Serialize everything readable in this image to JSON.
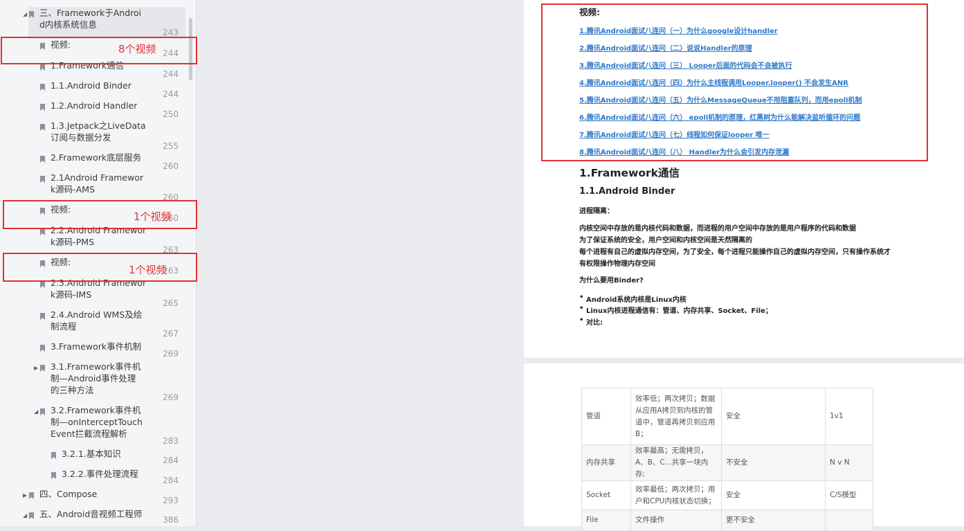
{
  "toc": [
    {
      "label": "三、Framework于Android内核系统信息",
      "lines": "三、Framework于Androi\nd内核系统信息",
      "page": "243",
      "expanded": true
    },
    {
      "label": "视频:",
      "lines": "视频:",
      "page": "244"
    },
    {
      "label": "1.Framework通信",
      "lines": "1.Framework通信",
      "page": "244"
    },
    {
      "label": "1.1.Android Binder",
      "lines": "1.1.Android Binder",
      "page": "244"
    },
    {
      "label": "1.2.Android Handler",
      "lines": "1.2.Android Handler",
      "page": "250"
    },
    {
      "label": "1.3.Jetpack之LiveData订阅与数据分发",
      "lines": "1.3.Jetpack之LiveData\n订阅与数据分发",
      "page": "255"
    },
    {
      "label": "2.Framework底层服务",
      "lines": "2.Framework底层服务",
      "page": "260"
    },
    {
      "label": "2.1Android Framework源码-AMS",
      "lines": "2.1Android Framewor\nk源码-AMS",
      "page": "260"
    },
    {
      "label": "视频:",
      "lines": "视频:",
      "page": "260"
    },
    {
      "label": "2.2.Android Framework源码-PMS",
      "lines": "2.2.Android Framewor\nk源码-PMS",
      "page": "263"
    },
    {
      "label": "视频:",
      "lines": "视频:",
      "page": "263"
    },
    {
      "label": "2.3.Android Framework源码-IMS",
      "lines": "2.3.Android Framewor\nk源码-IMS",
      "page": "265"
    },
    {
      "label": "2.4.Android WMS及绘制流程",
      "lines": "2.4.Android WMS及绘\n制流程",
      "page": "267"
    },
    {
      "label": "3.Framework事件机制",
      "lines": "3.Framework事件机制",
      "page": "269"
    },
    {
      "label": "3.1.Framework事件机制—Android事件处理的三种方法",
      "lines": "3.1.Framework事件机\n制—Android事件处理\n的三种方法",
      "page": "269",
      "collapsed": true
    },
    {
      "label": "3.2.Framework事件机制—onInterceptTouchEvent拦截流程解析",
      "lines": "3.2.Framework事件机\n制—onInterceptTouch\nEvent拦截流程解析",
      "page": "283",
      "expanded": true
    },
    {
      "label": "3.2.1.基本知识",
      "lines": "3.2.1.基本知识",
      "page": "284"
    },
    {
      "label": "3.2.2.事件处理流程",
      "lines": "3.2.2.事件处理流程",
      "page": "284"
    },
    {
      "label": "四、Compose",
      "lines": "四、Compose",
      "page": "293",
      "collapsed": true
    },
    {
      "label": "五、Android音视频工程师",
      "lines": "五、Android音视频工程师",
      "page": "386",
      "expanded": true
    }
  ],
  "annotations": [
    "8个视频",
    "1个视频",
    "1个视频"
  ],
  "doc": {
    "video_heading": "视频:",
    "video_links": [
      "1.腾讯Android面试八连问（一）为什么google设计handler",
      "2.腾讯Android面试八连问（二）说说Handler的原理",
      "3.腾讯Android面试八连问（三） Looper后面的代码会不会被执行",
      "4.腾讯Android面试八连问（四）为什么主线程调用Looper.looper() 不会发生ANR",
      "5.腾讯Android面试八连问（五）为什么MessageQueue不用阻塞队列，而用epoll机制",
      "6.腾讯Android面试八连问（六） epoll机制的原理，红黑树为什么能解决监听循环的问题",
      "7.腾讯Android面试八连问（七）线程如何保证looper 唯一",
      "8.腾讯Android面试八连问（八） Handler为什么会引发内存泄漏"
    ],
    "h1": "1.Framework通信",
    "h2": "1.1.Android Binder",
    "isolation_title": "进程隔离：",
    "isolation_paras": [
      "内核空间中存放的是内核代码和数据，而进程的用户空间中存放的是用户程序的代码和数据",
      "为了保证系统的安全，用户空间和内核空间是天然隔离的",
      "每个进程有自己的虚拟内存空间，为了安全，每个进程只能操作自己的虚拟内存空间，只有操作系统才",
      "有权限操作物理内存空间"
    ],
    "why_binder": "为什么要用Binder?",
    "bullets": [
      "Android系统内核是Linux内核",
      "Linux内核进程通信有：管道、内存共享、Socket、File；",
      "对比:"
    ]
  },
  "table": [
    {
      "name": "管道",
      "perf": "效率低；两次拷贝；数据从应用A拷贝到内核的管道中，管道再拷贝到应用B；",
      "safety": "安全",
      "mode": "1v1"
    },
    {
      "name": "内存共享",
      "perf": "效率最高；无需拷贝，A、B、C...共享一块内存;",
      "safety": "不安全",
      "mode": "N v N"
    },
    {
      "name": "Socket",
      "perf": "效率最低；两次拷贝；用户和CPU内核状态切换；",
      "safety": "安全",
      "mode": "C/S模型"
    },
    {
      "name": "File",
      "perf": "文件操作",
      "safety": "更不安全",
      "mode": ""
    }
  ]
}
